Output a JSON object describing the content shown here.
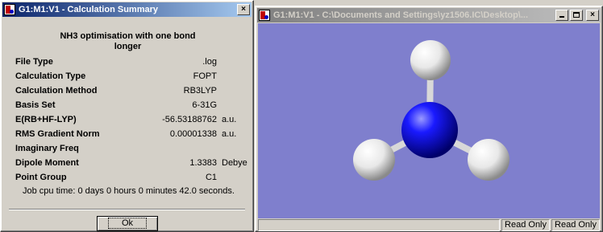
{
  "summary_window": {
    "title": "G1:M1:V1 - Calculation Summary",
    "close_glyph": "×",
    "heading_line1": "NH3 optimisation with one bond",
    "heading_line2": "longer",
    "rows": [
      {
        "label": "File Type",
        "value": ".log",
        "unit": ""
      },
      {
        "label": "Calculation Type",
        "value": "FOPT",
        "unit": ""
      },
      {
        "label": "Calculation Method",
        "value": "RB3LYP",
        "unit": ""
      },
      {
        "label": "Basis Set",
        "value": "6-31G",
        "unit": ""
      },
      {
        "label": "E(RB+HF-LYP)",
        "value": "-56.53188762",
        "unit": "a.u."
      },
      {
        "label": "RMS Gradient Norm",
        "value": "0.00001338",
        "unit": "a.u."
      },
      {
        "label": "Imaginary Freq",
        "value": "",
        "unit": ""
      },
      {
        "label": "Dipole Moment",
        "value": "1.3383",
        "unit": "Debye"
      },
      {
        "label": "Point Group",
        "value": "C1",
        "unit": ""
      }
    ],
    "cpu_time": "Job cpu time:  0 days  0 hours  0 minutes 42.0 seconds.",
    "ok_label": "Ok"
  },
  "viewer_window": {
    "title": "G1:M1:V1 - C:\\Documents and Settings\\yz1506.IC\\Desktop\\...",
    "minimize_glyph": "_",
    "maximize_glyph": "□",
    "close_glyph": "×",
    "status_left": "",
    "status_panel1": "Read Only",
    "status_panel2": "Read Only"
  },
  "molecule": {
    "formula": "NH3",
    "atoms": [
      {
        "element": "N",
        "color": "#1a1aff"
      },
      {
        "element": "H",
        "color": "#ffffff"
      },
      {
        "element": "H",
        "color": "#ffffff"
      },
      {
        "element": "H",
        "color": "#ffffff"
      }
    ],
    "background_color": "#7f7fcd",
    "bond_color": "#d8d8d8"
  }
}
